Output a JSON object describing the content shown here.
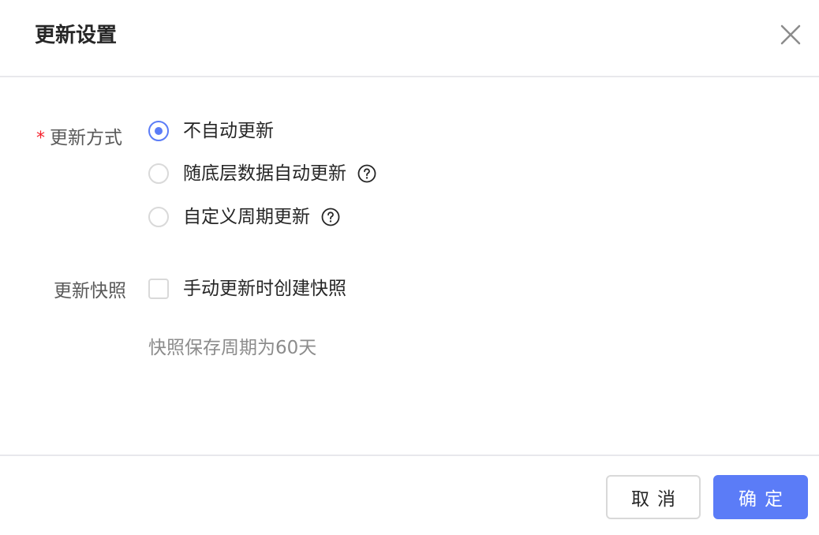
{
  "dialog": {
    "title": "更新设置"
  },
  "form": {
    "update_mode": {
      "label": "更新方式",
      "required_mark": "*",
      "options": [
        {
          "label": "不自动更新",
          "checked": true,
          "has_help": false
        },
        {
          "label": "随底层数据自动更新",
          "checked": false,
          "has_help": true
        },
        {
          "label": "自定义周期更新",
          "checked": false,
          "has_help": true
        }
      ]
    },
    "snapshot": {
      "label": "更新快照",
      "checkbox_label": "手动更新时创建快照",
      "checked": false,
      "hint": "快照保存周期为60天"
    }
  },
  "footer": {
    "cancel_label": "取消",
    "ok_label": "确定"
  },
  "colors": {
    "accent": "#5b7cf7",
    "required": "#f5222d",
    "hint": "#8c8c8c"
  },
  "icons": {
    "close": "close-icon",
    "help": "question-circle-icon"
  }
}
